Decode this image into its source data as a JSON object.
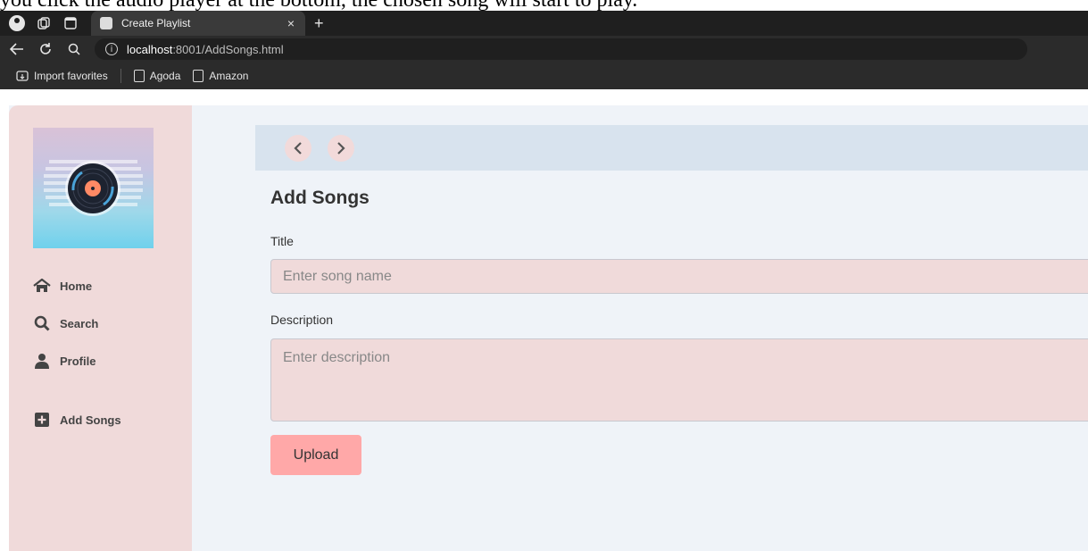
{
  "caption": "you click the audio player at the bottom, the chosen song will start to play.",
  "browser": {
    "tab_title": "Create Playlist",
    "tab_close": "×",
    "new_tab": "+",
    "url_host": "localhost",
    "url_rest": ":8001/AddSongs.html",
    "bookmarks": [
      "Import favorites",
      "Agoda",
      "Amazon"
    ]
  },
  "sidebar": {
    "items": [
      {
        "label": "Home",
        "icon": "home-icon"
      },
      {
        "label": "Search",
        "icon": "search-icon"
      },
      {
        "label": "Profile",
        "icon": "user-icon"
      },
      {
        "label": "Add Songs",
        "icon": "plus-square-icon"
      }
    ]
  },
  "main": {
    "title": "Add Songs",
    "title_label": "Title",
    "title_placeholder": "Enter song name",
    "description_label": "Description",
    "description_placeholder": "Enter description",
    "upload_label": "Upload"
  },
  "colors": {
    "sidebar_bg": "#f0dada",
    "main_bg": "#eff3f8",
    "topbar_bg": "#d8e3ee",
    "input_bg": "#f0dada",
    "button_bg": "#ffa8a8"
  }
}
